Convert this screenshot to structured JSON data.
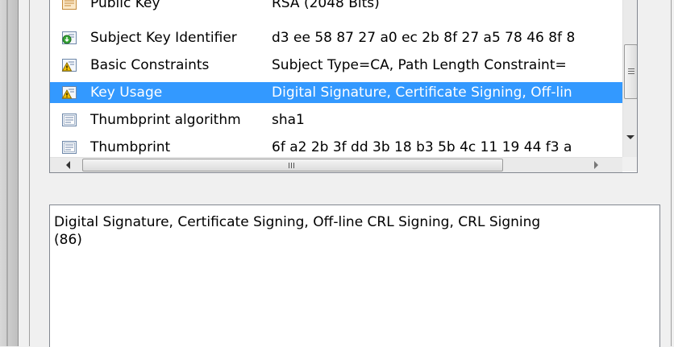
{
  "fields": [
    {
      "name": "Public Key",
      "value": "RSA (2048 Bits)",
      "icon": "certificate-field-icon",
      "selected": false
    },
    {
      "name": "Subject Key Identifier",
      "value": "d3 ee 58 87 27 a0 ec 2b 8f 27 a5 78 46 8f 8",
      "icon": "extension-field-icon",
      "selected": false
    },
    {
      "name": "Basic Constraints",
      "value": "Subject Type=CA, Path Length Constraint=",
      "icon": "critical-extension-warning-icon",
      "selected": false
    },
    {
      "name": "Key Usage",
      "value": "Digital Signature, Certificate Signing, Off-lin",
      "icon": "critical-extension-warning-icon",
      "selected": true
    },
    {
      "name": "Thumbprint algorithm",
      "value": "sha1",
      "icon": "property-field-icon",
      "selected": false
    },
    {
      "name": "Thumbprint",
      "value": "6f a2 2b 3f dd 3b 18 b3 5b 4c 11 19 44 f3 a",
      "icon": "property-field-icon",
      "selected": false
    }
  ],
  "detail_text": "Digital Signature, Certificate Signing, Off-line CRL Signing, CRL Signing\n(86)",
  "colors": {
    "selection": "#3399ff",
    "warning": "#f2c100"
  }
}
